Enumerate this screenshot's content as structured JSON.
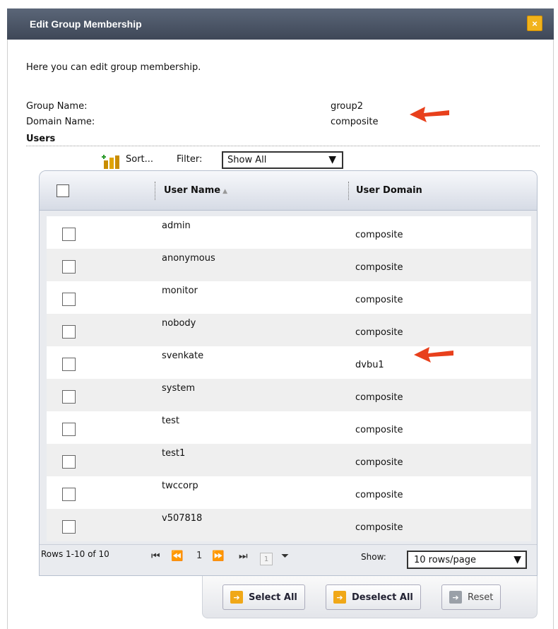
{
  "dialog": {
    "title": "Edit Group Membership",
    "close_icon": "close-icon"
  },
  "intro": "Here you can edit group membership.",
  "fields": {
    "group_name_label": "Group Name:",
    "group_name_value": "group2",
    "domain_name_label": "Domain Name:",
    "domain_name_value": "composite"
  },
  "users_section_title": "Users",
  "toolbar": {
    "sort_label": "Sort...",
    "filter_label": "Filter:",
    "filter_value": "Show All"
  },
  "grid": {
    "columns": [
      "User Name",
      "User Domain"
    ],
    "rows": [
      {
        "user": "admin",
        "domain": "composite"
      },
      {
        "user": "anonymous",
        "domain": "composite"
      },
      {
        "user": "monitor",
        "domain": "composite"
      },
      {
        "user": "nobody",
        "domain": "composite"
      },
      {
        "user": "svenkate",
        "domain": "dvbu1"
      },
      {
        "user": "system",
        "domain": "composite"
      },
      {
        "user": "test",
        "domain": "composite"
      },
      {
        "user": "test1",
        "domain": "composite"
      },
      {
        "user": "twccorp",
        "domain": "composite"
      },
      {
        "user": "v507818",
        "domain": "composite"
      }
    ]
  },
  "pagination": {
    "rows_info": "Rows 1-10 of 10",
    "current_page": "1",
    "page_input": "1",
    "show_label": "Show:",
    "show_value": "10 rows/page"
  },
  "buttons": {
    "select_all": "Select All",
    "deselect_all": "Deselect All",
    "reset": "Reset"
  },
  "colors": {
    "titlebar": "#4a5365",
    "accent": "#f0a818",
    "annotation_arrow": "#e8401c"
  }
}
